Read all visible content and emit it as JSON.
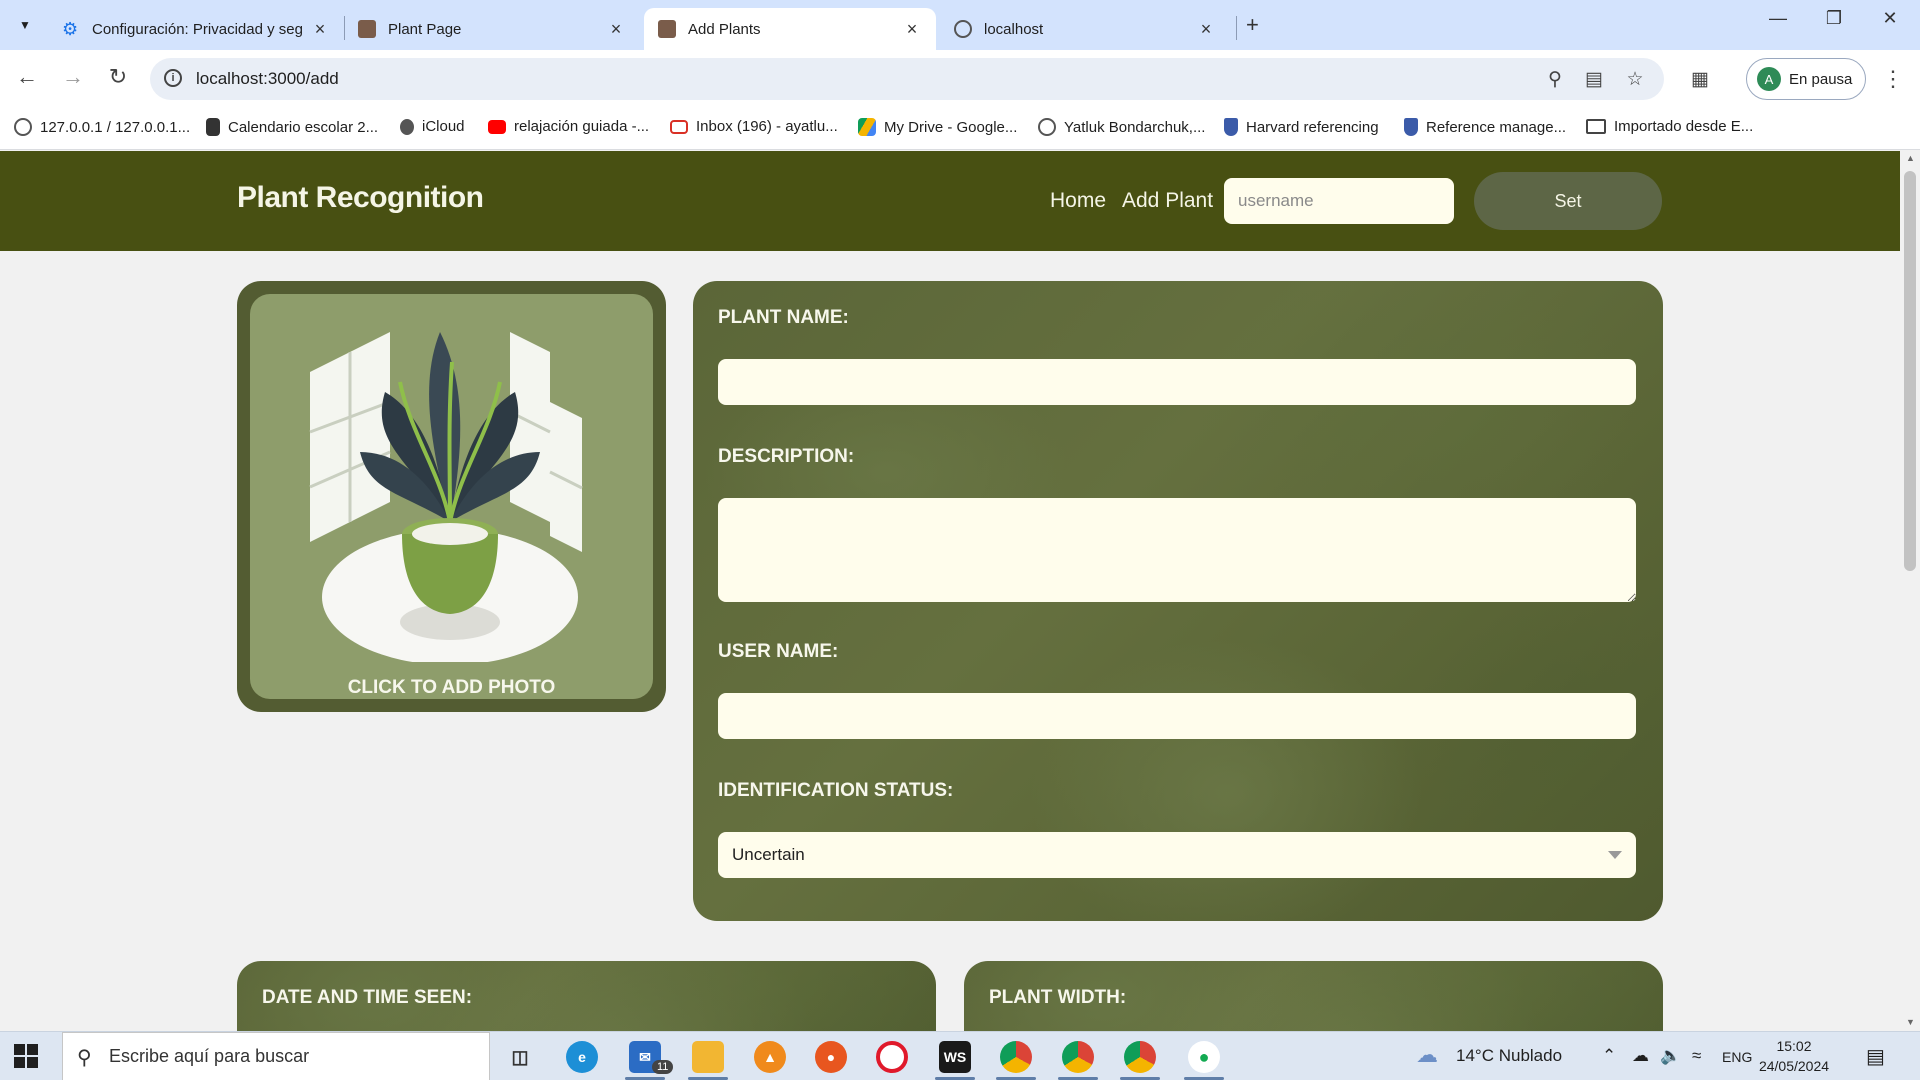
{
  "browser": {
    "tabs": [
      {
        "title": "Configuración: Privacidad y seg",
        "active": false
      },
      {
        "title": "Plant Page",
        "active": false
      },
      {
        "title": "Add Plants",
        "active": true
      },
      {
        "title": "localhost",
        "active": false
      }
    ],
    "url": "localhost:3000/add",
    "profile_initial": "A",
    "profile_label": "En pausa",
    "bookmarks": [
      "127.0.0.1 / 127.0.0.1...",
      "Calendario escolar 2...",
      "iCloud",
      "relajación guiada -...",
      "Inbox (196) - ayatlu...",
      "My Drive - Google...",
      "Yatluk Bondarchuk,...",
      "Harvard referencing",
      "Reference manage...",
      "Importado desde E..."
    ]
  },
  "site": {
    "brand": "Plant Recognition",
    "nav": {
      "home": "Home",
      "add_plant": "Add Plant"
    },
    "username_placeholder": "username",
    "set_label": "Set"
  },
  "photo": {
    "label": "CLICK TO ADD PHOTO"
  },
  "form": {
    "plant_name_label": "PLANT NAME:",
    "plant_name_value": "",
    "description_label": "DESCRIPTION:",
    "description_value": "",
    "user_name_label": "USER NAME:",
    "user_name_value": "",
    "status_label": "IDENTIFICATION STATUS:",
    "status_selected": "Uncertain"
  },
  "lower": {
    "date_label": "DATE AND TIME SEEN:",
    "width_label": "PLANT WIDTH:"
  },
  "taskbar": {
    "search_placeholder": "Escribe aquí para buscar",
    "mail_badge": "11",
    "weather": "14°C  Nublado",
    "language": "ENG",
    "time": "15:02",
    "date": "24/05/2024"
  },
  "colors": {
    "header": "#485012",
    "card": "#5b6638",
    "input_bg": "#fffdec",
    "set_button": "#5d6646"
  }
}
